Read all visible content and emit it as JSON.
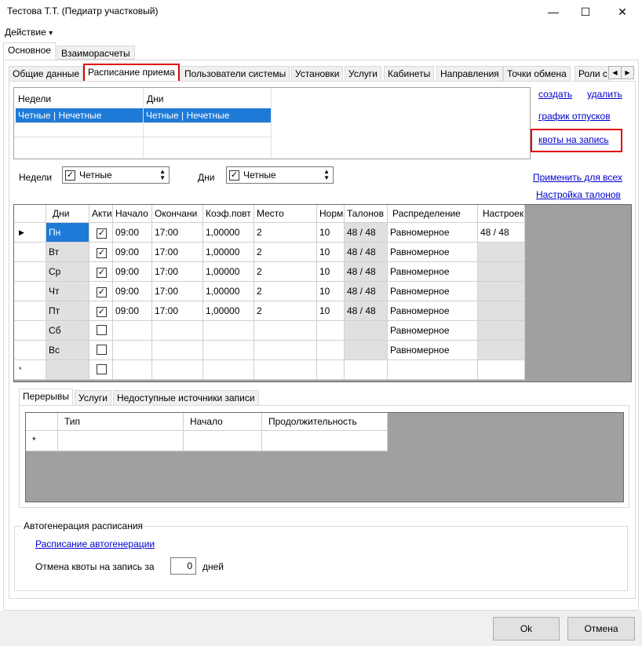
{
  "window": {
    "title": "Тестова Т.Т. (Педиатр участковый)"
  },
  "menu": {
    "action": "Действие",
    "action_arrow": "▾"
  },
  "main_tabs": [
    "Основное",
    "Взаиморасчеты"
  ],
  "sub_tabs": [
    "Общие данные",
    "Расписание приема",
    "Пользователи системы",
    "Установки",
    "Услуги",
    "Кабинеты",
    "Направления",
    "Точки обмена",
    "Роли с"
  ],
  "weeks_grid": {
    "headers": [
      "Недели",
      "Дни"
    ],
    "rows": [
      [
        "Четные | Нечетные",
        "Четные | Нечетные"
      ]
    ]
  },
  "links": {
    "create": "создать",
    "delete": "удалить",
    "vacation": "график отпусков",
    "quotas": "квоты на запись",
    "apply_all": "Применить для всех",
    "ticket_setup": "Настройка талонов",
    "autogen_schedule": "Расписание автогенерации"
  },
  "filters": {
    "weeks_label": "Недели",
    "weeks_value": "Четные",
    "days_label": "Дни",
    "days_value": "Четные"
  },
  "schedule": {
    "headers": [
      "Дни",
      "Акти",
      "Начало",
      "Окончани",
      "Коэф.повт",
      "Место",
      "Норм",
      "Талонов",
      "Распределение",
      "Настроек"
    ],
    "rows": [
      {
        "day": "Пн",
        "active": true,
        "start": "09:00",
        "end": "17:00",
        "coef": "1,00000",
        "place": "2",
        "norm": "10",
        "tickets": "48 / 48",
        "dist": "Равномерное",
        "settings": "48 / 48"
      },
      {
        "day": "Вт",
        "active": true,
        "start": "09:00",
        "end": "17:00",
        "coef": "1,00000",
        "place": "2",
        "norm": "10",
        "tickets": "48 / 48",
        "dist": "Равномерное",
        "settings": ""
      },
      {
        "day": "Ср",
        "active": true,
        "start": "09:00",
        "end": "17:00",
        "coef": "1,00000",
        "place": "2",
        "norm": "10",
        "tickets": "48 / 48",
        "dist": "Равномерное",
        "settings": ""
      },
      {
        "day": "Чт",
        "active": true,
        "start": "09:00",
        "end": "17:00",
        "coef": "1,00000",
        "place": "2",
        "norm": "10",
        "tickets": "48 / 48",
        "dist": "Равномерное",
        "settings": ""
      },
      {
        "day": "Пт",
        "active": true,
        "start": "09:00",
        "end": "17:00",
        "coef": "1,00000",
        "place": "2",
        "norm": "10",
        "tickets": "48 / 48",
        "dist": "Равномерное",
        "settings": ""
      },
      {
        "day": "Сб",
        "active": false,
        "start": "",
        "end": "",
        "coef": "",
        "place": "",
        "norm": "",
        "tickets": "",
        "dist": "Равномерное",
        "settings": ""
      },
      {
        "day": "Вс",
        "active": false,
        "start": "",
        "end": "",
        "coef": "",
        "place": "",
        "norm": "",
        "tickets": "",
        "dist": "Равномерное",
        "settings": ""
      }
    ]
  },
  "bottom_tabs": [
    "Перерывы",
    "Услуги",
    "Недоступные источники записи"
  ],
  "breaks": {
    "headers": [
      "Тип",
      "Начало",
      "Продолжительность"
    ],
    "new_row_marker": "*"
  },
  "autogen": {
    "title": "Автогенерация расписания",
    "cancel_label": "Отмена квоты на запись за",
    "cancel_value": "0",
    "days_suffix": "дней"
  },
  "buttons": {
    "ok": "Ok",
    "cancel": "Отмена"
  }
}
